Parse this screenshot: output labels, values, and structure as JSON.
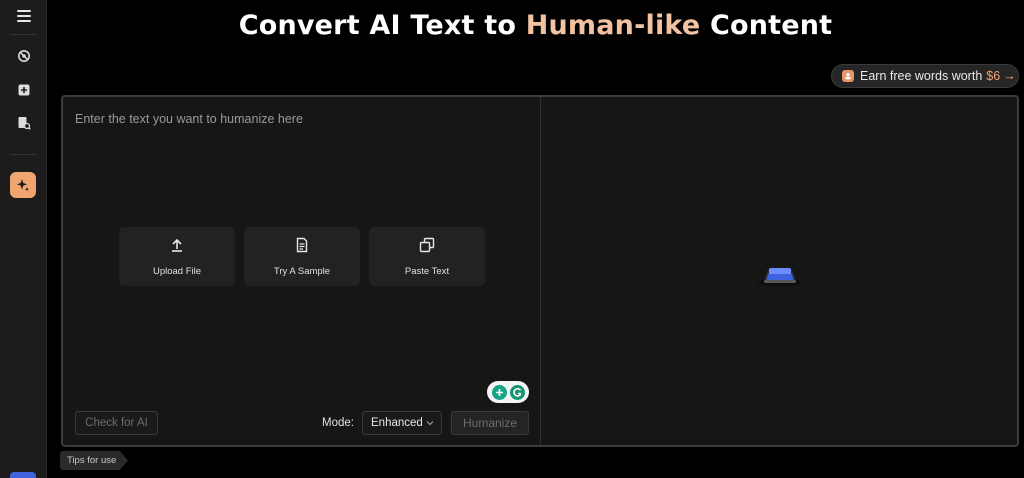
{
  "sidebar": {
    "items": [
      {
        "name": "menu-icon"
      },
      {
        "name": "ai-detector-icon"
      },
      {
        "name": "add-document-icon"
      },
      {
        "name": "plagiarism-search-icon"
      },
      {
        "name": "humanizer-sparkle-icon",
        "active": true
      }
    ],
    "active_color": "#f0a570"
  },
  "header": {
    "title_before": "Convert AI Text to",
    "title_highlight": "Human-like",
    "title_after": "Content",
    "highlight_color": "#f3c2a0"
  },
  "promo": {
    "text": "Earn free words worth",
    "amount": "$6",
    "arrow": "→"
  },
  "editor": {
    "placeholder": "Enter the text you want to humanize here",
    "actions": [
      {
        "label": "Upload File",
        "icon": "upload-icon"
      },
      {
        "label": "Try A Sample",
        "icon": "document-icon"
      },
      {
        "label": "Paste Text",
        "icon": "paste-icon"
      }
    ],
    "check_button": "Check for AI",
    "mode_label": "Mode:",
    "mode_value": "Enhanced",
    "humanize_button": "Humanize"
  },
  "output": {
    "empty_icon": "empty-box-icon"
  },
  "tips": {
    "label": "Tips for use"
  }
}
